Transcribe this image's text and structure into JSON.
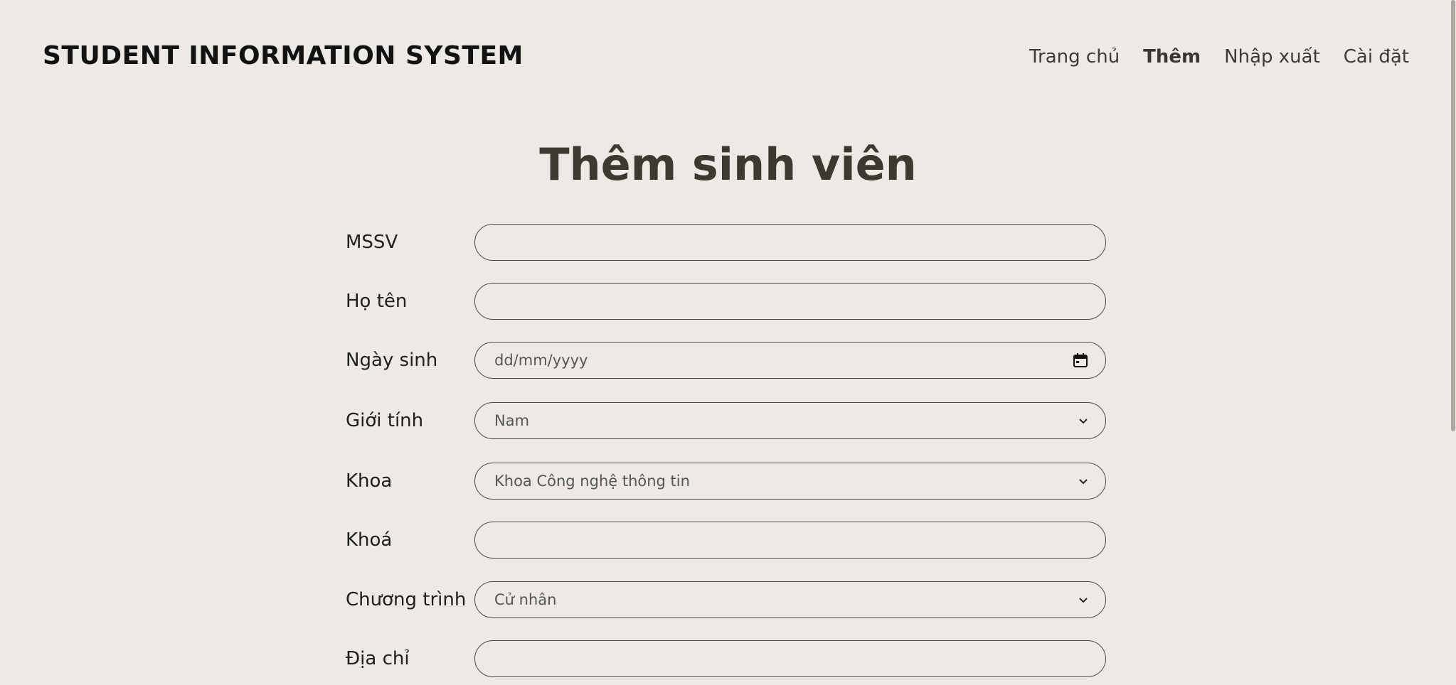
{
  "header": {
    "brand": "STUDENT INFORMATION SYSTEM",
    "nav": [
      {
        "label": "Trang chủ",
        "active": false
      },
      {
        "label": "Thêm",
        "active": true
      },
      {
        "label": "Nhập xuất",
        "active": false
      },
      {
        "label": "Cài đặt",
        "active": false
      }
    ]
  },
  "main": {
    "title": "Thêm sinh viên",
    "fields": [
      {
        "label": "MSSV",
        "type": "text",
        "value": ""
      },
      {
        "label": "Họ tên",
        "type": "text",
        "value": ""
      },
      {
        "label": "Ngày sinh",
        "type": "date",
        "placeholder": "dd/mm/yyyy",
        "icon": "calendar-icon"
      },
      {
        "label": "Giới tính",
        "type": "select",
        "value": "Nam"
      },
      {
        "label": "Khoa",
        "type": "select",
        "value": "Khoa Công nghệ thông tin"
      },
      {
        "label": "Khoá",
        "type": "text",
        "value": ""
      },
      {
        "label": "Chương trình",
        "type": "select",
        "value": "Cử nhân"
      },
      {
        "label": "Địa chỉ",
        "type": "text",
        "value": ""
      }
    ]
  },
  "colors": {
    "background": "#edeae5",
    "title": "#3c3930",
    "border": "#4a4a4a"
  }
}
